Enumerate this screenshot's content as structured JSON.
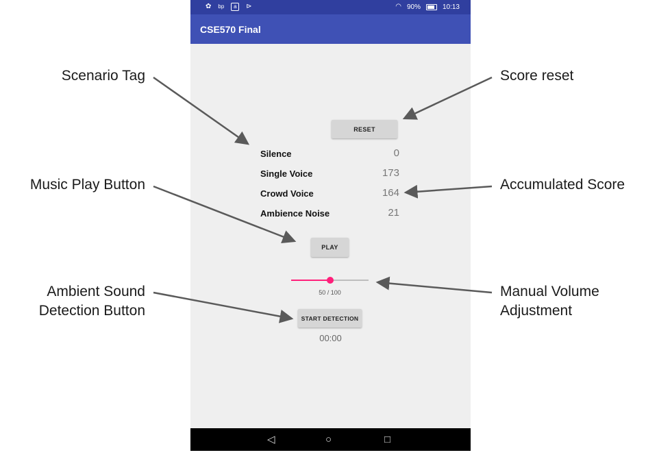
{
  "status_bar": {
    "icons": [
      "gear-icon",
      "app-icon",
      "sim-icon",
      "play-icon",
      "wifi-icon",
      "battery-icon"
    ],
    "battery": "90%",
    "time": "10:13",
    "color": "#303f9f"
  },
  "app": {
    "title": "CSE570 Final",
    "bar_color": "#3f51b5"
  },
  "reset_button": {
    "label": "RESET"
  },
  "scores": [
    {
      "label": "Silence",
      "value": "0"
    },
    {
      "label": "Single Voice",
      "value": "173"
    },
    {
      "label": "Crowd Voice",
      "value": "164"
    },
    {
      "label": "Ambience Noise",
      "value": "21"
    }
  ],
  "play_button": {
    "label": "PLAY"
  },
  "volume": {
    "value": 50,
    "max": 100,
    "readout": "50 / 100",
    "accent": "#ff1f7a"
  },
  "detection_button": {
    "label": "START DETECTION"
  },
  "timer": "00:00",
  "nav": {
    "back": "◁",
    "home": "○",
    "recents": "□"
  },
  "callouts": {
    "scenario_tag": "Scenario Tag",
    "score_reset": "Score reset",
    "music_play": "Music Play Button",
    "accumulated_score": "Accumulated Score",
    "ambient_line1": "Ambient Sound",
    "ambient_line2": "Detection Button",
    "volume_line1": "Manual Volume",
    "volume_line2": "Adjustment"
  }
}
